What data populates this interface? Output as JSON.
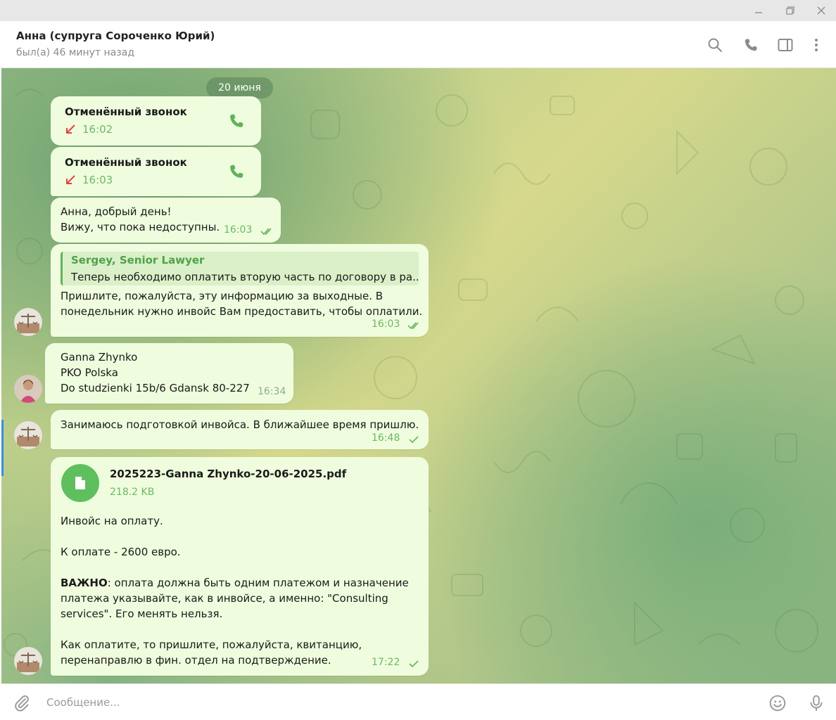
{
  "window": {
    "controls": [
      "minimize-icon",
      "restore-icon",
      "close-icon"
    ]
  },
  "header": {
    "title": "Анна (супруга Сороченко Юрий)",
    "status": "был(а) 46 минут назад",
    "icons": [
      "search-icon",
      "phone-icon",
      "sidebar-toggle-icon",
      "more-vertical-icon"
    ]
  },
  "chat": {
    "date_badge": "20 июня",
    "messages": [
      {
        "type": "call",
        "title": "Отменённый звонок",
        "time": "16:02"
      },
      {
        "type": "call",
        "title": "Отменённый звонок",
        "time": "16:03"
      },
      {
        "type": "text",
        "lines": [
          "Анна, добрый день!",
          "Вижу, что пока недоступны."
        ],
        "time": "16:03",
        "status": "read"
      },
      {
        "type": "reply",
        "reply_author": "Sergey, Senior Lawyer",
        "reply_text": "Теперь необходимо оплатить вторую часть по договору в ра...",
        "lines": [
          "Пришлите, пожалуйста, эту информацию за выходные. В",
          "понедельник нужно инвойс Вам предоставить, чтобы оплатили."
        ],
        "time": "16:03",
        "status": "read"
      },
      {
        "type": "text",
        "lines": [
          "Ganna Zhynko",
          "PKO Polska",
          "Do studzienki 15b/6 Gdansk 80-227"
        ],
        "time": "16:34",
        "status": "incoming"
      },
      {
        "type": "text",
        "lines": [
          "Занимаюсь подготовкой инвойса. В ближайшее время пришлю."
        ],
        "time": "16:48",
        "status": "sent"
      },
      {
        "type": "file",
        "file_name": "2025223-Ganna Zhynko-20-06-2025.pdf",
        "file_size": "218.2 KB",
        "caption": {
          "line1": "Инвойс на оплату.",
          "line2": "К оплате - 2600 евро.",
          "important_label": "ВАЖНО",
          "important_rest": ": оплата должна быть одним платежом и назначение",
          "line4": "платежа указывайте, как в инвойсе, а именно: \"Consulting",
          "line5": "services\". Его менять нельзя.",
          "line6": "Как оплатите, то пришлите, пожалуйста, квитанцию,",
          "line7": "перенаправлю в фин. отдел на подтверждение."
        },
        "time": "17:22",
        "status": "sent"
      }
    ]
  },
  "composer": {
    "placeholder": "Сообщение...",
    "icons": [
      "attach-icon",
      "emoji-icon",
      "microphone-icon"
    ]
  },
  "colors": {
    "bubble": "#effdde",
    "accent_green": "#6cb865",
    "reply_green": "#4ea24a",
    "missed_red": "#e0443b"
  }
}
